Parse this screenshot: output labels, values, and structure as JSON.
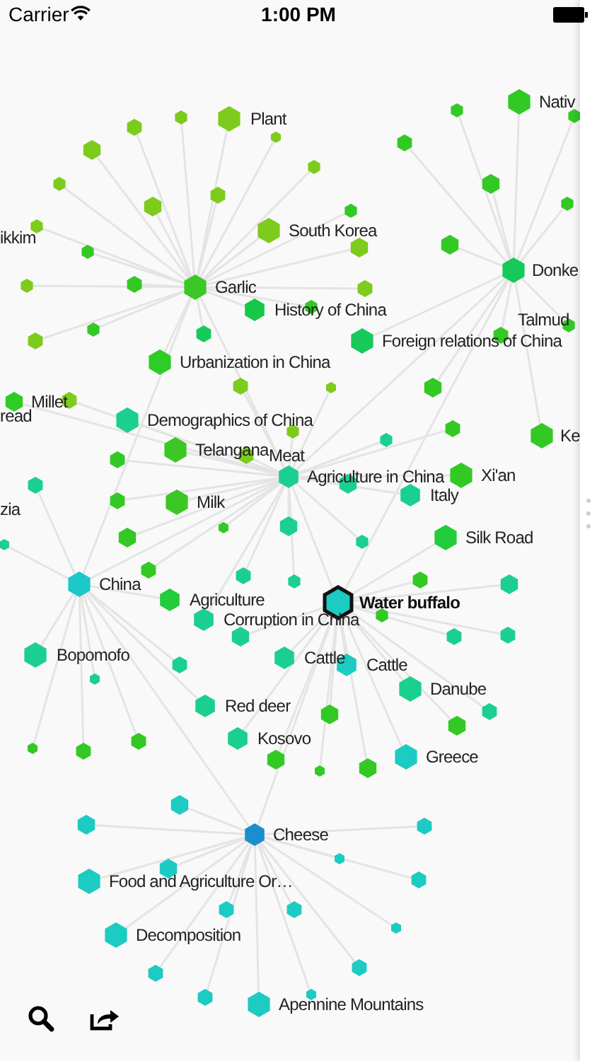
{
  "status_bar": {
    "carrier": "Carrier",
    "time": "1:00 PM"
  },
  "nodes": [
    {
      "label": "Nativ",
      "color": "#33c924",
      "selected": false
    },
    {
      "label": "Plant",
      "color": "#7dcb1c",
      "selected": false
    },
    {
      "label": "South Korea",
      "color": "#7dcb1c",
      "selected": false
    },
    {
      "label": "ikkim",
      "selected": false
    },
    {
      "label": "Garlic",
      "color": "#3cc824",
      "selected": false
    },
    {
      "label": "Donke",
      "color": "#16c95a",
      "selected": false
    },
    {
      "label": "History of China",
      "color": "#16c748",
      "selected": false
    },
    {
      "label": "Talmud",
      "selected": false
    },
    {
      "label": "Foreign relations of China",
      "color": "#16c95a",
      "selected": false
    },
    {
      "label": "Urbanization in China",
      "color": "#2ecc26",
      "selected": false
    },
    {
      "label": "Millet",
      "color": "#2ecc26",
      "selected": false
    },
    {
      "label": "read",
      "selected": false
    },
    {
      "label": "Demographics of China",
      "color": "#1bcf8e",
      "selected": false
    },
    {
      "label": "Ke",
      "color": "#33c924",
      "selected": false
    },
    {
      "label": "Telangana",
      "color": "#3cc824",
      "selected": false
    },
    {
      "label": "Meat",
      "color": "#7dcb1c",
      "selected": false
    },
    {
      "label": "Agriculture in China",
      "color": "#1bcf92",
      "selected": false
    },
    {
      "label": "Xi'an",
      "color": "#33c924",
      "selected": false
    },
    {
      "label": "Italy",
      "color": "#1bcf92",
      "selected": false
    },
    {
      "label": "zia",
      "selected": false
    },
    {
      "label": "Milk",
      "color": "#3cc824",
      "selected": false
    },
    {
      "label": "Silk Road",
      "color": "#22cc3a",
      "selected": false
    },
    {
      "label": "China",
      "color": "#1cc8c8",
      "selected": false
    },
    {
      "label": "Water buffalo",
      "color": "#1ccbc2",
      "selected": true
    },
    {
      "label": "Agriculture",
      "color": "#22cc3a",
      "selected": false
    },
    {
      "label": "Corruption in China",
      "color": "#1bcf92",
      "selected": false
    },
    {
      "label": "Bopomofo",
      "color": "#1bcf92",
      "selected": false
    },
    {
      "label": "Cattle",
      "color": "#1bcf92",
      "selected": false
    },
    {
      "label": "Cattle",
      "color": "#1ccbc2",
      "selected": false
    },
    {
      "label": "Danube",
      "color": "#1bcf8e",
      "selected": false
    },
    {
      "label": "Red deer",
      "color": "#1bcf8e",
      "selected": false
    },
    {
      "label": "Kosovo",
      "color": "#1bcf8e",
      "selected": false
    },
    {
      "label": "Greece",
      "color": "#1ccbc2",
      "selected": false
    },
    {
      "label": "Cheese",
      "color": "#1a8fd0",
      "selected": false
    },
    {
      "label": "Food and Agriculture Or…",
      "color": "#1ccbc2",
      "selected": false
    },
    {
      "label": "Decomposition",
      "color": "#1ccbc2",
      "selected": false
    },
    {
      "label": "Apennine Mountains",
      "color": "#1ccbc2",
      "selected": false
    }
  ]
}
